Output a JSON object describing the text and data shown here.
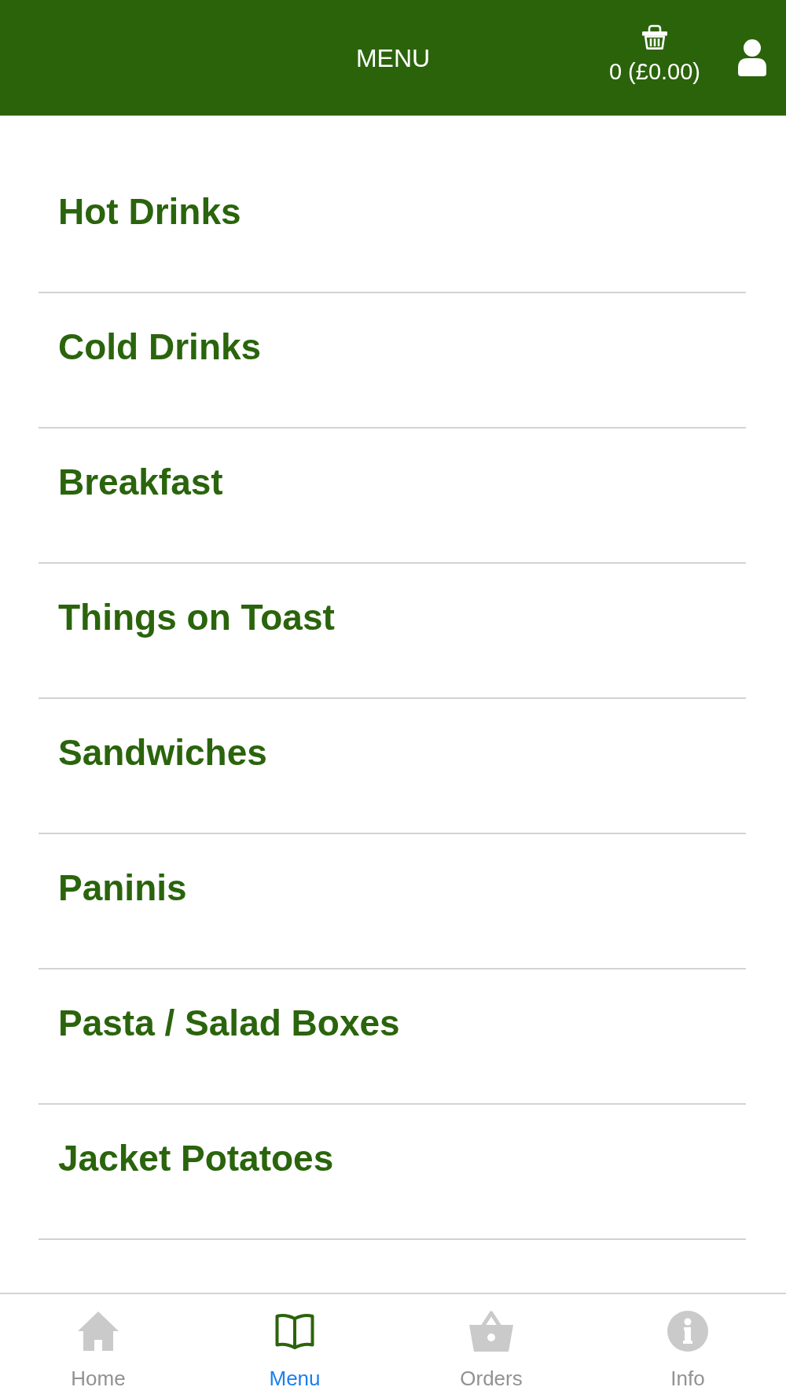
{
  "header": {
    "title": "MENU",
    "cart_summary": "0 (£0.00)"
  },
  "categories": [
    "Hot Drinks",
    "Cold Drinks",
    "Breakfast",
    "Things on Toast",
    "Sandwiches",
    "Paninis",
    "Pasta / Salad Boxes",
    "Jacket Potatoes"
  ],
  "tab_bar": {
    "tabs": [
      {
        "label": "Home",
        "selected": false
      },
      {
        "label": "Menu",
        "selected": true
      },
      {
        "label": "Orders",
        "selected": false
      },
      {
        "label": "Info",
        "selected": false
      }
    ]
  }
}
